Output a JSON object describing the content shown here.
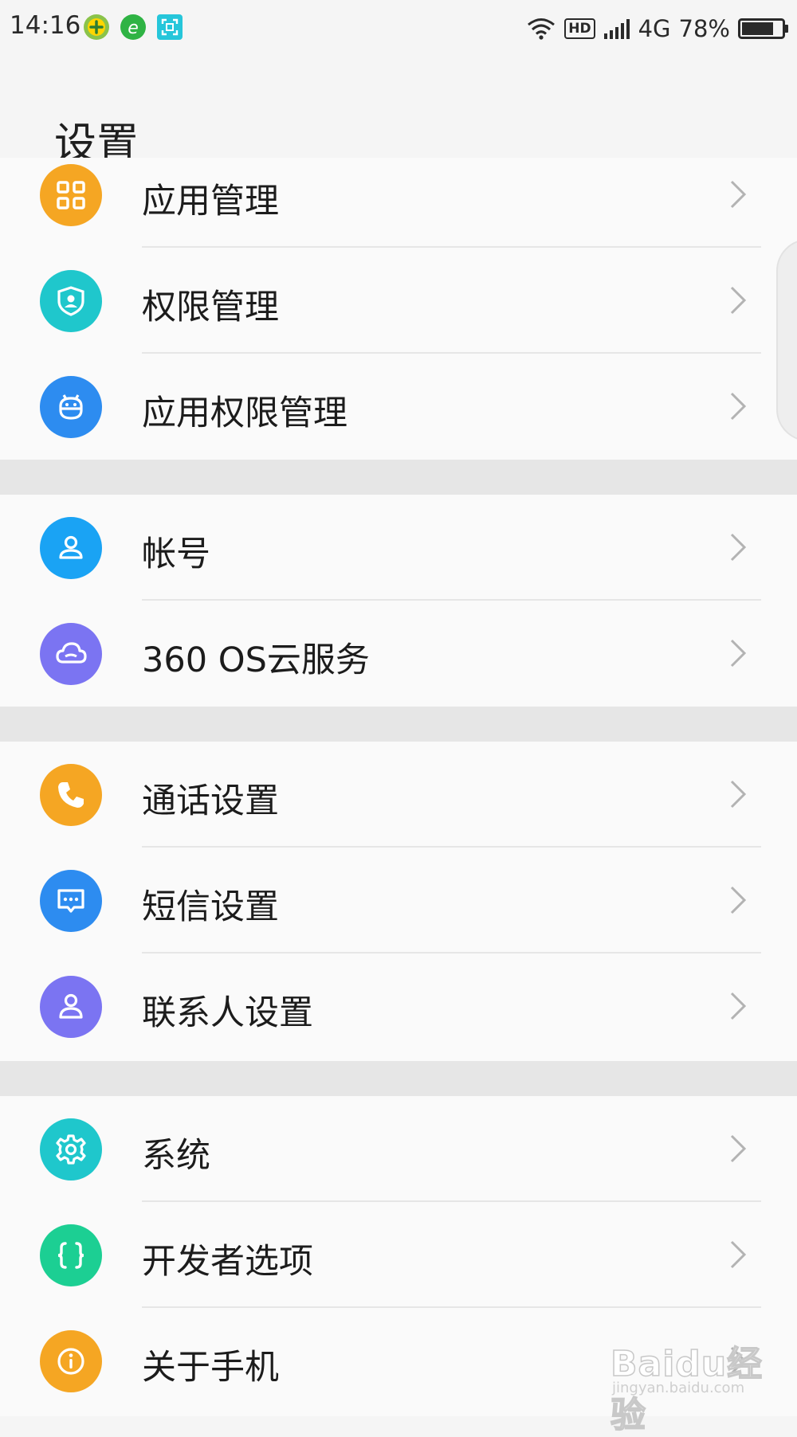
{
  "status_bar": {
    "time": "14:16",
    "hd": "HD",
    "network": "4G",
    "battery": "78%",
    "battery_level": 0.78,
    "notification_icons": [
      "360-plus-icon",
      "browser-e-icon",
      "scan-icon"
    ]
  },
  "header": {
    "title": "设置"
  },
  "groups": [
    {
      "items": [
        {
          "label": "应用管理",
          "icon": "grid-apps-icon",
          "color": "#f5a623"
        },
        {
          "label": "权限管理",
          "icon": "shield-user-icon",
          "color": "#1fc7cc"
        },
        {
          "label": "应用权限管理",
          "icon": "android-icon",
          "color": "#2d8cf0"
        }
      ]
    },
    {
      "items": [
        {
          "label": "帐号",
          "icon": "person-icon",
          "color": "#1aa3f4"
        },
        {
          "label": "360 OS云服务",
          "icon": "cloud-icon",
          "color": "#7b74f2"
        }
      ]
    },
    {
      "items": [
        {
          "label": "通话设置",
          "icon": "phone-icon",
          "color": "#f5a623"
        },
        {
          "label": "短信设置",
          "icon": "message-icon",
          "color": "#2d8cf0"
        },
        {
          "label": "联系人设置",
          "icon": "contact-icon",
          "color": "#7b74f2"
        }
      ]
    },
    {
      "items": [
        {
          "label": "系统",
          "icon": "gear-icon",
          "color": "#1fc7cc"
        },
        {
          "label": "开发者选项",
          "icon": "braces-icon",
          "color": "#1ccf93"
        },
        {
          "label": "关于手机",
          "icon": "info-icon",
          "color": "#f5a623"
        }
      ]
    }
  ],
  "watermark": {
    "main": "Baidu经验",
    "sub": "jingyan.baidu.com"
  }
}
